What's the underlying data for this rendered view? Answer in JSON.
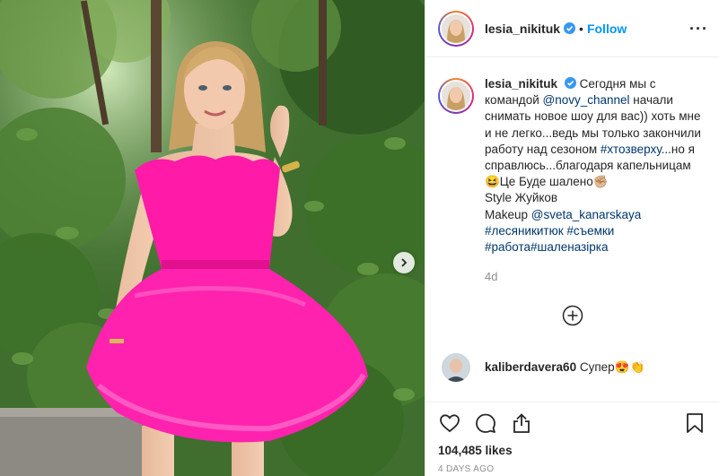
{
  "post": {
    "author": {
      "username": "lesia_nikituk",
      "verified": true,
      "follow_label": "Follow",
      "separator": "•"
    },
    "more_icon": "more-options-icon",
    "caption": {
      "username": "lesia_nikituk",
      "line1": "Сегодня мы с командой ",
      "mention1": "@novy_channel",
      "line2": " начали снимать новое шоу для вас)) хоть мне и не легко...ведь мы только закончили работу над сезоном ",
      "hashtag1": "#хтозверху",
      "line3": "...но я справлюсь...благодаря капельницам",
      "line4": "😆Це Буде шалено✊🏼",
      "line5": "Style Жуйков",
      "makeup_label": "Makeup ",
      "mention2": "@sveta_kanarskaya",
      "hashtag2": "#лесяникитюк",
      "hashtag3": "#съемки",
      "hashtag4": "#работа",
      "hashtag5": "#шаленазірка",
      "time_ago": "4d"
    },
    "comments": [
      {
        "username": "kaliberdavera60",
        "text": "Супер😍👏"
      }
    ],
    "likes": "104,485 likes",
    "date": "4 DAYS AGO",
    "icons": {
      "like": "heart-icon",
      "comment": "comment-icon",
      "share": "share-icon",
      "save": "bookmark-icon",
      "load_more": "plus-circle-icon",
      "carousel_next": "chevron-right-icon"
    },
    "colors": {
      "link": "#00376b",
      "follow": "#0095f6",
      "muted": "#8e8e8e",
      "dress": "#ff1aa8"
    }
  }
}
